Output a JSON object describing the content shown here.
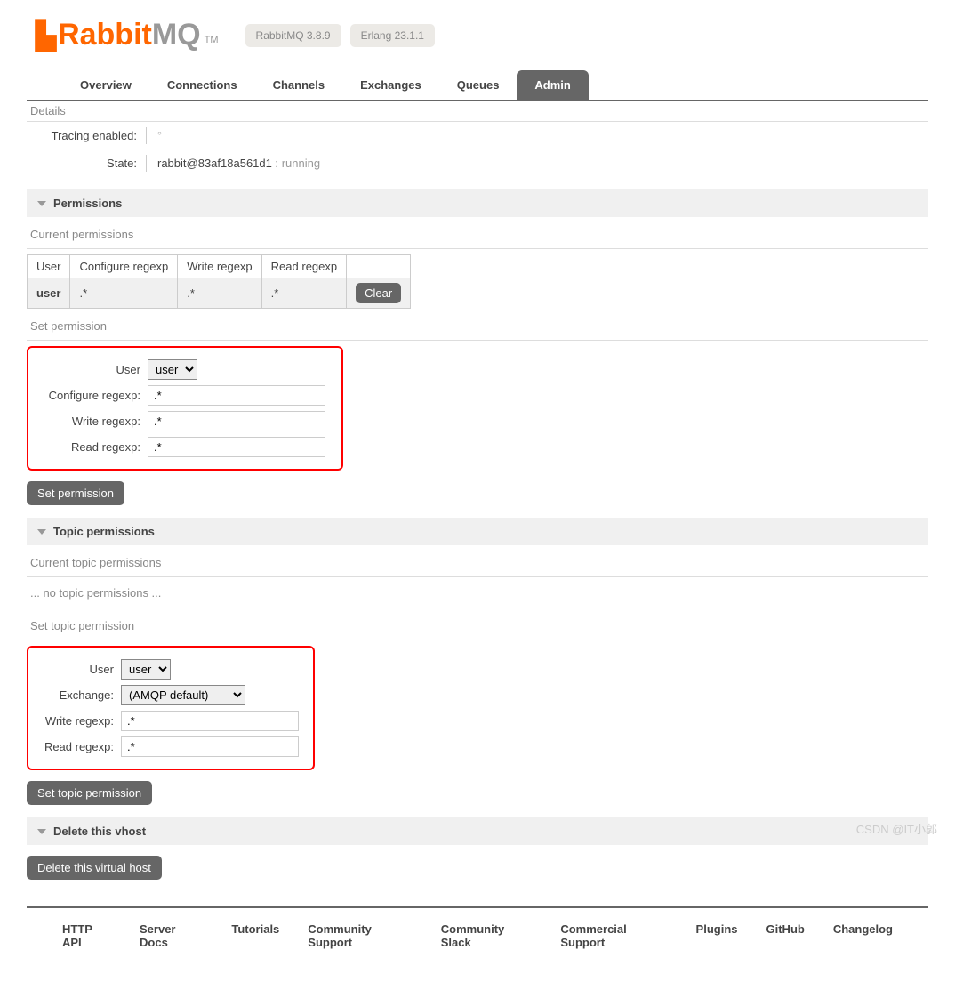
{
  "header": {
    "logo_rabbit": "Rabbit",
    "logo_mq": "MQ",
    "logo_tm": "TM",
    "version_badge": "RabbitMQ 3.8.9",
    "erlang_badge": "Erlang 23.1.1"
  },
  "tabs": {
    "items": [
      {
        "label": "Overview",
        "active": false
      },
      {
        "label": "Connections",
        "active": false
      },
      {
        "label": "Channels",
        "active": false
      },
      {
        "label": "Exchanges",
        "active": false
      },
      {
        "label": "Queues",
        "active": false
      },
      {
        "label": "Admin",
        "active": true
      }
    ]
  },
  "details": {
    "title": "Details",
    "tracing_label": "Tracing enabled:",
    "tracing_value": "○",
    "state_label": "State:",
    "state_node": "rabbit@83af18a561d1 :",
    "state_status": "running"
  },
  "permissions": {
    "header": "Permissions",
    "current_label": "Current permissions",
    "columns": [
      "User",
      "Configure regexp",
      "Write regexp",
      "Read regexp"
    ],
    "row": {
      "user": "user",
      "configure": ".*",
      "write": ".*",
      "read": ".*"
    },
    "clear_btn": "Clear",
    "set_label": "Set permission",
    "form": {
      "user_label": "User",
      "user_value": "user",
      "configure_label": "Configure regexp:",
      "configure_value": ".*",
      "write_label": "Write regexp:",
      "write_value": ".*",
      "read_label": "Read regexp:",
      "read_value": ".*"
    },
    "set_btn": "Set permission"
  },
  "topic_permissions": {
    "header": "Topic permissions",
    "current_label": "Current topic permissions",
    "no_perms": "... no topic permissions ...",
    "set_label": "Set topic permission",
    "form": {
      "user_label": "User",
      "user_value": "user",
      "exchange_label": "Exchange:",
      "exchange_value": "(AMQP default)",
      "write_label": "Write regexp:",
      "write_value": ".*",
      "read_label": "Read regexp:",
      "read_value": ".*"
    },
    "set_btn": "Set topic permission"
  },
  "delete_vhost": {
    "header": "Delete this vhost",
    "btn": "Delete this virtual host"
  },
  "footer": {
    "links": [
      "HTTP API",
      "Server Docs",
      "Tutorials",
      "Community Support",
      "Community Slack",
      "Commercial Support",
      "Plugins",
      "GitHub",
      "Changelog"
    ]
  },
  "watermark": "CSDN @IT小郭"
}
